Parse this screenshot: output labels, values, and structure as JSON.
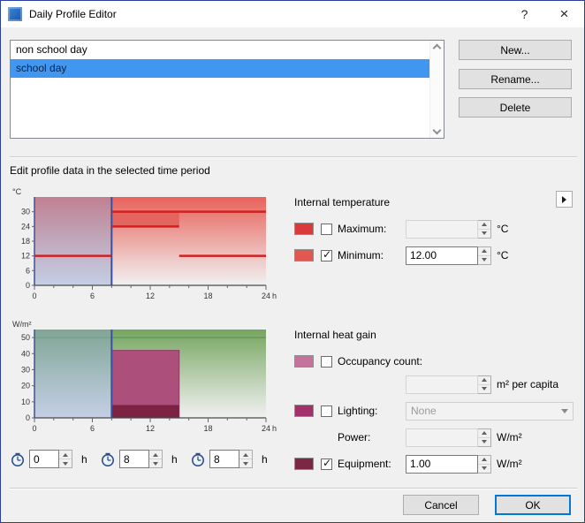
{
  "colors": {
    "dialog_border": "#2b3f9e",
    "dialog_bg": "#f0f0f0",
    "titlebar_bg": "#ffffff",
    "selection": "#4196f0",
    "default_button": "#0078d7"
  },
  "window": {
    "title": "Daily Profile Editor",
    "help_label": "?",
    "close_label": "×"
  },
  "profile_list": {
    "items": [
      {
        "label": "non school day",
        "selected": false
      },
      {
        "label": "school day",
        "selected": true
      }
    ]
  },
  "actions": {
    "new_label": "New...",
    "rename_label": "Rename...",
    "delete_label": "Delete"
  },
  "edit_section_label": "Edit profile data in the selected time period",
  "time_fields": [
    {
      "value": "0",
      "unit": "h"
    },
    {
      "value": "8",
      "unit": "h"
    },
    {
      "value": "8",
      "unit": "h"
    }
  ],
  "temperature_panel": {
    "header": "Internal temperature",
    "maximum": {
      "label": "Maximum:",
      "checked": false,
      "value": "",
      "unit": "°C",
      "swatch": "#da3a39"
    },
    "minimum": {
      "label": "Minimum:",
      "checked": true,
      "value": "12.00",
      "unit": "°C",
      "swatch": "#e25750"
    }
  },
  "heatgain_panel": {
    "header": "Internal heat gain",
    "occupancy": {
      "label": "Occupancy count:",
      "checked": false,
      "value": "",
      "unit": "m² per capita",
      "swatch": "#c4739c"
    },
    "lighting": {
      "label": "Lighting:",
      "checked": false,
      "value": "None",
      "swatch": "#a2306a"
    },
    "power": {
      "label": "Power:",
      "value": "",
      "unit": "W/m²"
    },
    "equipment": {
      "label": "Equipment:",
      "checked": true,
      "value": "1.00",
      "unit": "W/m²",
      "swatch": "#7c2744"
    }
  },
  "footer": {
    "cancel_label": "Cancel",
    "ok_label": "OK"
  },
  "chart_data": [
    {
      "type": "line",
      "name": "temperature",
      "title": "",
      "ylabel": "°C",
      "x_unit": "h",
      "ylim": [
        0,
        36
      ],
      "yticks": [
        0,
        6,
        12,
        18,
        24,
        30
      ],
      "xlim": [
        0,
        24
      ],
      "xticks": [
        0,
        6,
        12,
        18,
        24
      ],
      "selection": {
        "start": 0,
        "end": 8
      },
      "series": [
        {
          "name": "maximum",
          "segments": [
            {
              "from": 8,
              "to": 24,
              "value": 30
            }
          ]
        },
        {
          "name": "minimum",
          "segments": [
            {
              "from": 0,
              "to": 8,
              "value": 12
            },
            {
              "from": 8,
              "to": 15,
              "value": 24
            },
            {
              "from": 15,
              "to": 24,
              "value": 12
            }
          ]
        }
      ],
      "band": {
        "from": 8,
        "to": 15,
        "low": 24,
        "high": 30
      },
      "colors": {
        "line": "#d02020",
        "fill_top": "#e85a52",
        "band": "#e4655e",
        "selection": "#8fa6d8",
        "selection_edge": "#3a4f9e"
      }
    },
    {
      "type": "bar",
      "name": "heat-gain",
      "title": "",
      "ylabel": "W/m²",
      "x_unit": "h",
      "ylim": [
        0,
        55
      ],
      "yticks": [
        0,
        10,
        20,
        30,
        40,
        50
      ],
      "xlim": [
        0,
        24
      ],
      "xticks": [
        0,
        6,
        12,
        18,
        24
      ],
      "selection": {
        "start": 0,
        "end": 8
      },
      "background_level": 50,
      "bars": [
        {
          "name": "lighting",
          "from": 8,
          "to": 15,
          "value": 42
        },
        {
          "name": "equipment",
          "from": 8,
          "to": 15,
          "value": 8
        }
      ],
      "colors": {
        "fill_top": "#6fa259",
        "background_line": "#699754",
        "lighting": "#ad4f7b",
        "lighting_edge": "#8e3a62",
        "equipment": "#7c2344",
        "selection": "#8fa6d8",
        "selection_edge": "#3a4f9e"
      }
    }
  ]
}
